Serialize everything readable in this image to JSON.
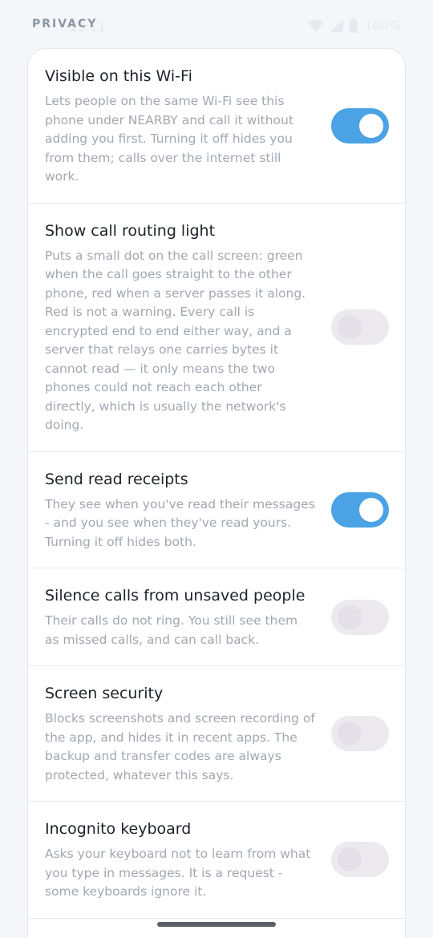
{
  "status_bar": {
    "time": "13:11",
    "battery": "100%"
  },
  "section": {
    "title": "PRIVACY"
  },
  "settings": [
    {
      "title": "Visible on this Wi-Fi",
      "description": "Lets people on the same Wi-Fi see this phone under NEARBY and call it without adding you first. Turning it off hides you from them; calls over the internet still work.",
      "enabled": true
    },
    {
      "title": "Show call routing light",
      "description": "Puts a small dot on the call screen: green when the call goes straight to the other phone, red when a server passes it along. Red is not a warning. Every call is encrypted end to end either way, and a server that relays one carries bytes it cannot read — it only means the two phones could not reach each other directly, which is usually the network's doing.",
      "enabled": false
    },
    {
      "title": "Send read receipts",
      "description": "They see when you've read their messages - and you see when they've read yours. Turning it off hides both.",
      "enabled": true
    },
    {
      "title": "Silence calls from unsaved people",
      "description": "Their calls do not ring. You still see them as missed calls, and can call back.",
      "enabled": false
    },
    {
      "title": "Screen security",
      "description": "Blocks screenshots and screen recording of the app, and hides it in recent apps. The backup and transfer codes are always protected, whatever this says.",
      "enabled": false
    },
    {
      "title": "Incognito keyboard",
      "description": "Asks your keyboard not to learn from what you type in messages. It is a request - some keyboards ignore it.",
      "enabled": false
    }
  ],
  "colors": {
    "toggle_on": "#4ba3e6",
    "toggle_off": "#ece9ef"
  }
}
